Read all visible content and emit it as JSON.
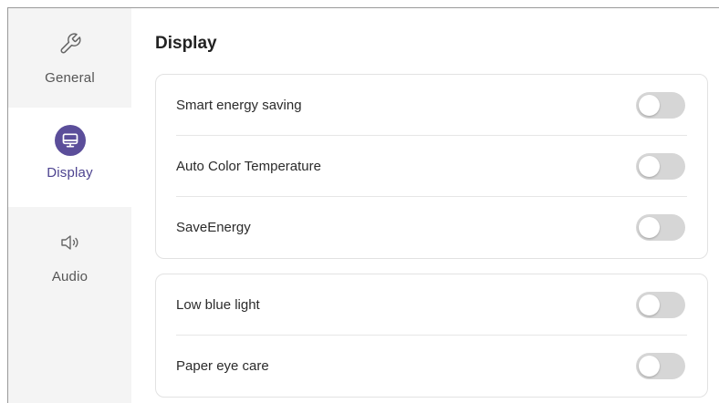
{
  "sidebar": {
    "items": [
      {
        "label": "General",
        "icon": "wrench-icon",
        "active": false
      },
      {
        "label": "Display",
        "icon": "monitor-icon",
        "active": true
      },
      {
        "label": "Audio",
        "icon": "speaker-icon",
        "active": false
      }
    ]
  },
  "main": {
    "title": "Display",
    "groups": [
      {
        "settings": [
          {
            "label": "Smart energy saving",
            "enabled": false
          },
          {
            "label": "Auto Color Temperature",
            "enabled": false
          },
          {
            "label": "SaveEnergy",
            "enabled": false
          }
        ]
      },
      {
        "settings": [
          {
            "label": "Low blue light",
            "enabled": false
          },
          {
            "label": "Paper eye care",
            "enabled": false
          }
        ]
      }
    ]
  },
  "colors": {
    "accent": "#5b4e9a",
    "toggle_off": "#d6d6d6",
    "sidebar_bg": "#f4f4f4"
  }
}
